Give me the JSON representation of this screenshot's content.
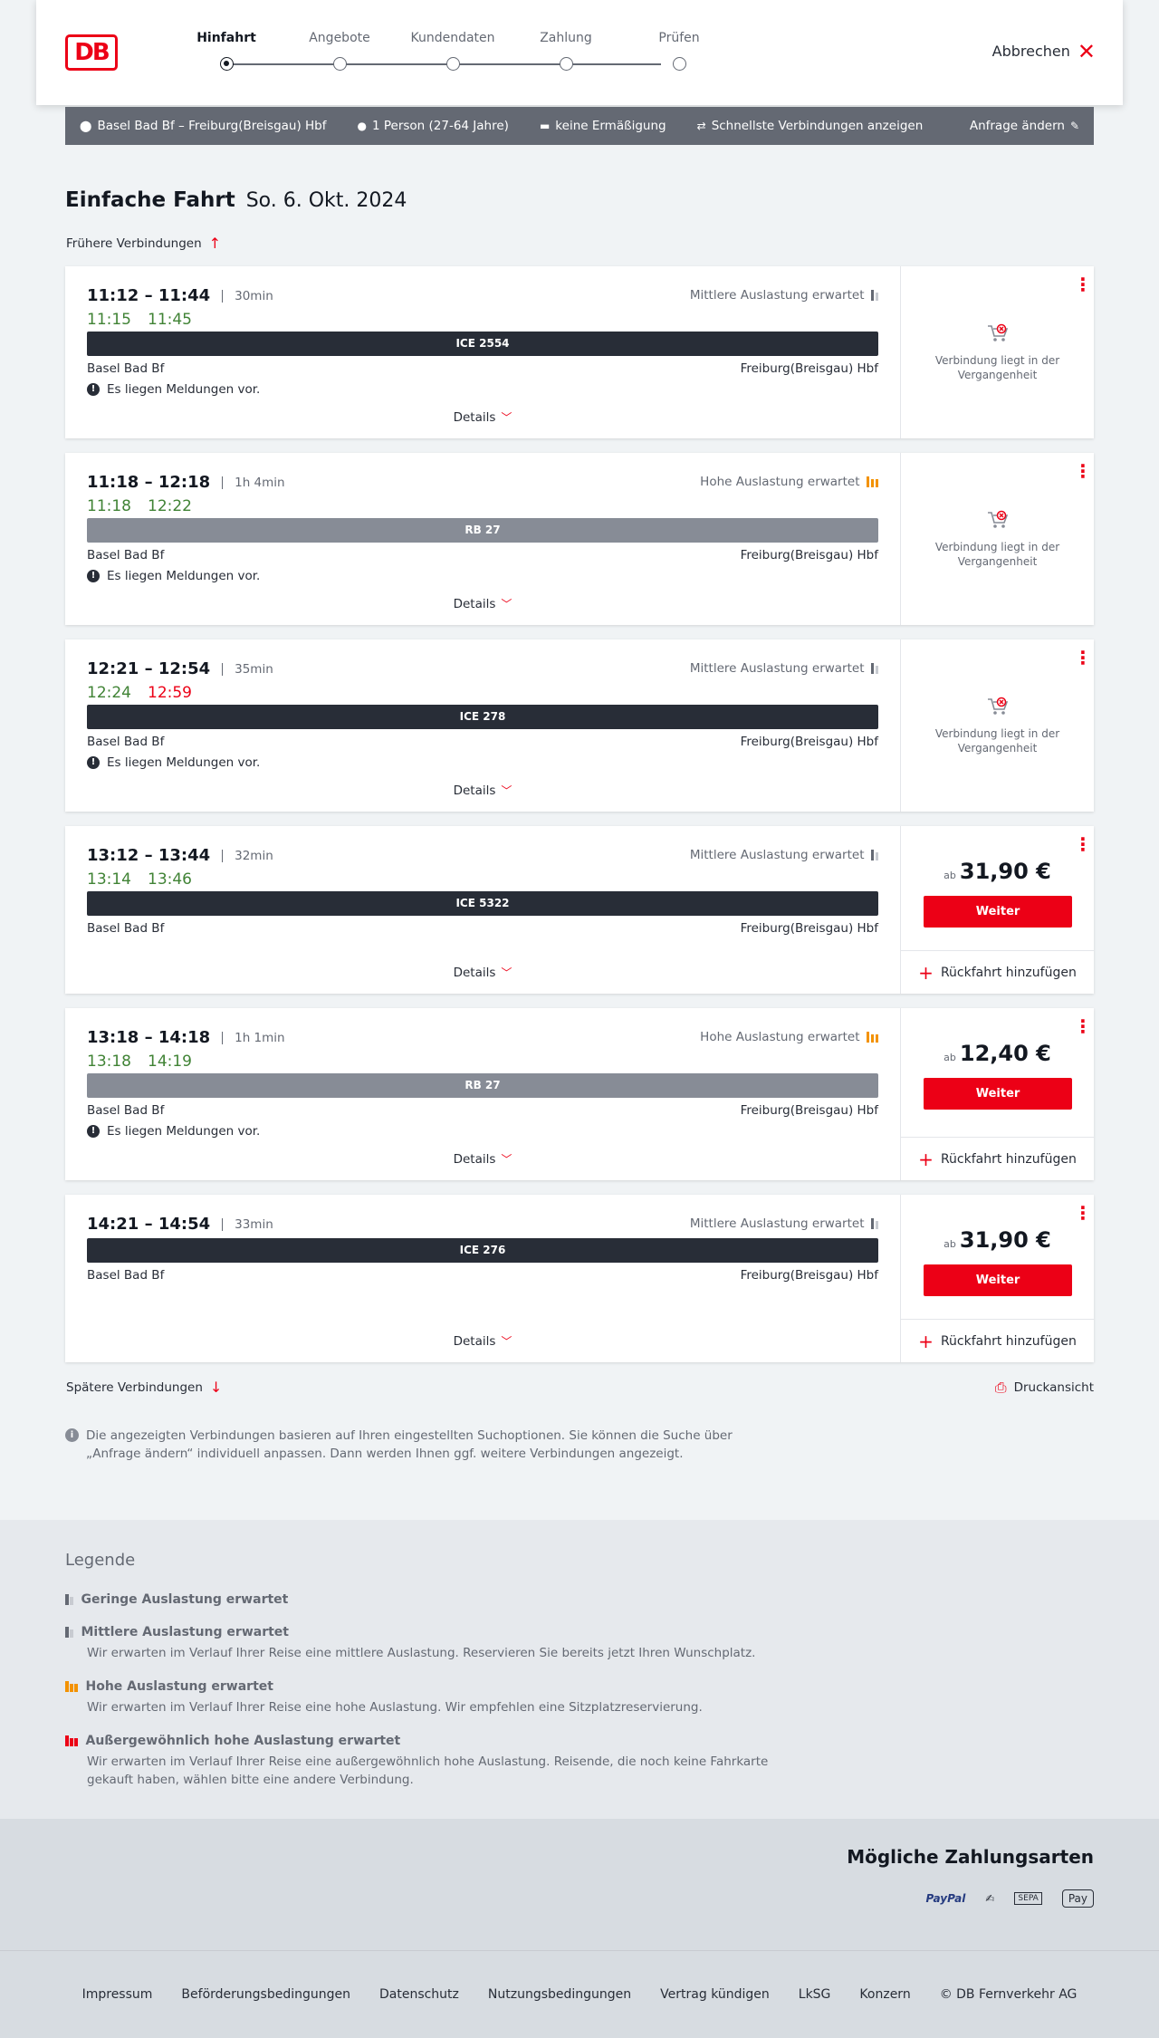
{
  "header": {
    "logo": "DB",
    "steps": [
      "Hinfahrt",
      "Angebote",
      "Kundendaten",
      "Zahlung",
      "Prüfen"
    ],
    "active_step": "Hinfahrt",
    "cancel_label": "Abbrechen"
  },
  "query": {
    "route": "Basel Bad Bf – Freiburg(Breisgau) Hbf",
    "persons": "1 Person (27-64 Jahre)",
    "discount": "keine Ermäßigung",
    "fastest": "Schnellste Verbindungen anzeigen",
    "change": "Anfrage ändern"
  },
  "title": {
    "main": "Einfache Fahrt",
    "date": "So. 6. Okt. 2024"
  },
  "earlier_label": "Frühere Verbindungen",
  "later_label": "Spätere Verbindungen",
  "print_label": "Druckansicht",
  "details_label": "Details",
  "past_label": "Verbindung liegt in der Vergangenheit",
  "price_prefix": "ab",
  "weiter_label": "Weiter",
  "return_label": "Rückfahrt hinzufügen",
  "connections": [
    {
      "plan": "11:12 – 11:44",
      "duration": "30min",
      "real_dep": "11:15",
      "real_arr": "11:45",
      "load": "Mittlere Auslastung erwartet",
      "train": "ICE 2554",
      "from": "Basel Bad Bf",
      "to": "Freiburg(Breisgau) Hbf",
      "notice": "Es liegen Meldungen vor."
    },
    {
      "plan": "11:18 – 12:18",
      "duration": "1h 4min",
      "real_dep": "11:18",
      "real_arr": "12:22",
      "load": "Hohe Auslastung erwartet",
      "train": "RB 27",
      "from": "Basel Bad Bf",
      "to": "Freiburg(Breisgau) Hbf",
      "notice": "Es liegen Meldungen vor."
    },
    {
      "plan": "12:21 – 12:54",
      "duration": "35min",
      "real_dep": "12:24",
      "real_arr": "12:59",
      "load": "Mittlere Auslastung erwartet",
      "train": "ICE 278",
      "from": "Basel Bad Bf",
      "to": "Freiburg(Breisgau) Hbf",
      "notice": "Es liegen Meldungen vor."
    },
    {
      "plan": "13:12 – 13:44",
      "duration": "32min",
      "real_dep": "13:14",
      "real_arr": "13:46",
      "load": "Mittlere Auslastung erwartet",
      "train": "ICE 5322",
      "from": "Basel Bad Bf",
      "to": "Freiburg(Breisgau) Hbf",
      "price": "31,90 €"
    },
    {
      "plan": "13:18 – 14:18",
      "duration": "1h 1min",
      "real_dep": "13:18",
      "real_arr": "14:19",
      "load": "Hohe Auslastung erwartet",
      "train": "RB 27",
      "from": "Basel Bad Bf",
      "to": "Freiburg(Breisgau) Hbf",
      "notice": "Es liegen Meldungen vor.",
      "price": "12,40 €"
    },
    {
      "plan": "14:21 – 14:54",
      "duration": "33min",
      "load": "Mittlere Auslastung erwartet",
      "train": "ICE 276",
      "from": "Basel Bad Bf",
      "to": "Freiburg(Breisgau) Hbf",
      "price": "31,90 €"
    }
  ],
  "info_text": "Die angezeigten Verbindungen basieren auf Ihren eingestellten Suchoptionen. Sie können die Suche über „Anfrage ändern“ individuell anpassen. Dann werden Ihnen ggf. weitere Verbindungen angezeigt.",
  "legend": {
    "title": "Legende",
    "items": [
      {
        "label": "Geringe Auslastung erwartet",
        "desc": ""
      },
      {
        "label": "Mittlere Auslastung erwartet",
        "desc": "Wir erwarten im Verlauf Ihrer Reise eine mittlere Auslastung. Reservieren Sie bereits jetzt Ihren Wunschplatz."
      },
      {
        "label": "Hohe Auslastung erwartet",
        "desc": "Wir erwarten im Verlauf Ihrer Reise eine hohe Auslastung. Wir empfehlen eine Sitzplatzreservierung."
      },
      {
        "label": "Außergewöhnlich hohe Auslastung erwartet",
        "desc": "Wir erwarten im Verlauf Ihrer Reise eine außergewöhnlich hohe Auslastung. Reisende, die noch keine Fahrkarte gekauft haben, wählen bitte eine andere Verbindung."
      }
    ]
  },
  "payment": {
    "title": "Mögliche Zahlungsarten",
    "paypal": "PayPal",
    "sepa": "SEPA",
    "applepay": "Pay"
  },
  "footer": [
    "Impressum",
    "Beförderungsbedingungen",
    "Datenschutz",
    "Nutzungsbedingungen",
    "Vertrag kündigen",
    "LkSG",
    "Konzern",
    "© DB Fernverkehr AG"
  ],
  "colors": {
    "brand": "#ec0016",
    "on_time": "#408335",
    "high_load": "#f39200"
  }
}
